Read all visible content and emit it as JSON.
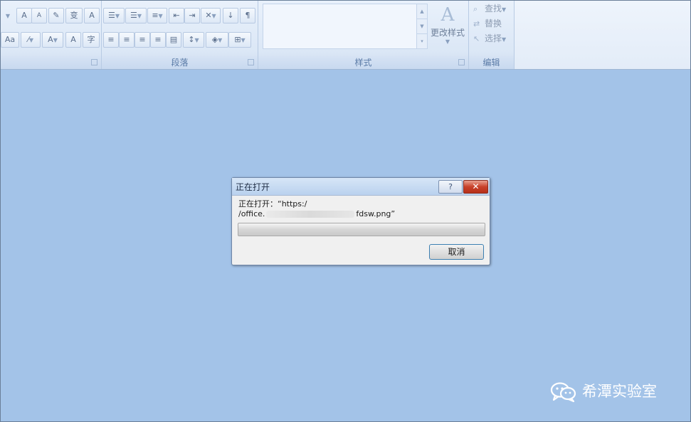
{
  "ribbon": {
    "groups": {
      "font": {
        "label": ""
      },
      "paragraph": {
        "label": "段落"
      },
      "styles": {
        "label": "样式",
        "change_styles_label": "更改样式"
      },
      "editing": {
        "label": "编辑",
        "find_label": "查找",
        "replace_label": "替换",
        "select_label": "选择"
      }
    },
    "font_buttons": {
      "grow_font": "A",
      "shrink_font": "A",
      "phonetic": "变",
      "char_border": "A",
      "change_case": "Aa",
      "font_color": "A",
      "char_shading": "A",
      "enclose_char": "字"
    }
  },
  "dialog": {
    "title": "正在打开",
    "help_label": "?",
    "close_label": "✕",
    "message_line1": "正在打开：“https:/",
    "message_line2_start": "/office.",
    "message_line2_end": "fdsw.png”",
    "cancel_label": "取消"
  },
  "watermark": {
    "text": "希潭实验室"
  },
  "colors": {
    "workspace": "#a3c3e8",
    "ribbon": "#dbe7f6",
    "close_button": "#c8412a"
  }
}
